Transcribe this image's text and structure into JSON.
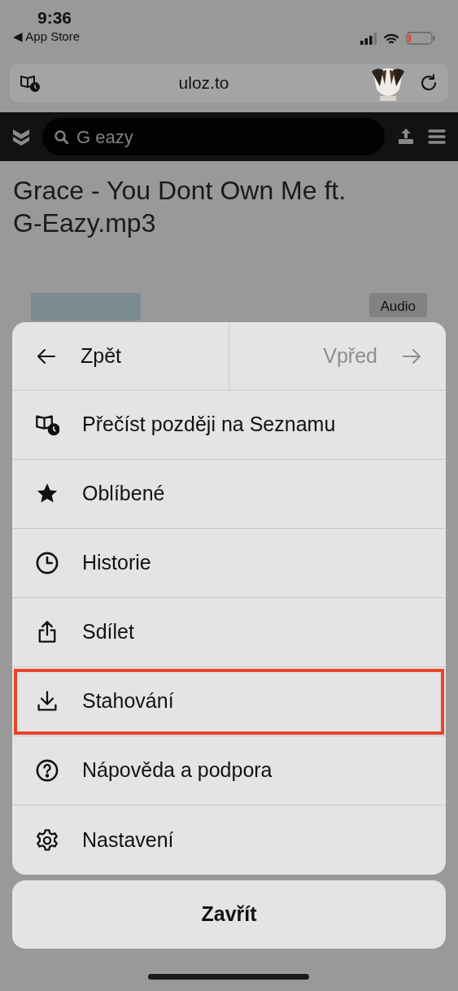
{
  "status_bar": {
    "time": "9:36",
    "back_app": "◀ App Store"
  },
  "address_bar": {
    "url": "uloz.to"
  },
  "site_header": {
    "search": {
      "value": "G eazy"
    }
  },
  "page": {
    "title": "Grace - You Dont Own Me ft. G-Eazy.mp3",
    "badge": "Audio"
  },
  "menu": {
    "back": {
      "label": "Zpět",
      "disabled": false
    },
    "forward": {
      "label": "Vpřed",
      "disabled": true
    },
    "items": [
      {
        "label": "Přečíst později na Seznamu",
        "highlighted": false
      },
      {
        "label": "Oblíbené",
        "highlighted": false
      },
      {
        "label": "Historie",
        "highlighted": false
      },
      {
        "label": "Sdílet",
        "highlighted": false
      },
      {
        "label": "Stahování",
        "highlighted": true
      },
      {
        "label": "Nápověda a podpora",
        "highlighted": false
      },
      {
        "label": "Nastavení",
        "highlighted": false
      }
    ]
  },
  "close_button": "Zavřít"
}
